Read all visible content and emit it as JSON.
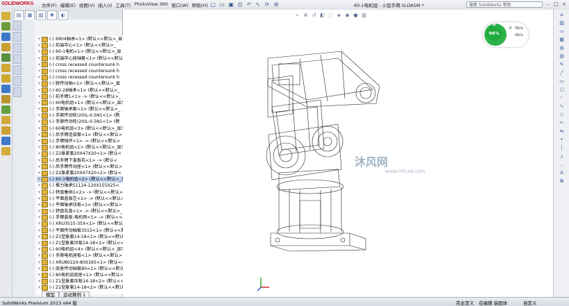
{
  "app": {
    "logo": "SOLIDWORKS",
    "menu": [
      "文件(F)",
      "编辑(E)",
      "视图(V)",
      "插入(I)",
      "工具(T)",
      "PhotoView 360",
      "窗口(W)",
      "帮助(H)"
    ],
    "document_title": "60-1电机组 - 小型手臂.SLDASM *",
    "search_placeholder": "搜索 SolidWorks 帮助"
  },
  "gauge": {
    "percent_label": "96%",
    "percent": 0.96,
    "legend": [
      "0",
      "0K/s",
      "0K/s"
    ]
  },
  "tree": {
    "items": [
      "(-) 6904轴承<1> (默认<<默认>_显",
      "(-) 前端中心<1> (默认<<默认>_",
      "(-) 60-1电机<1> (默认<<默认>_显",
      "(-) 前端中心座轴套<1> (默认<<默认>",
      "(-) cross recessed countersunk h",
      "(-) cross recessed countersunk h",
      "(-) cross recessed countersunk h",
      "(-) 腕传动轴<1> (默认<<默认>_显",
      "(-) 60-28轴承<1> (默认<<默认>_",
      "(-) 前手臂1<1> -> (默认<<默认>_",
      "(-) 60电机组<1> (默认<<默认>_显示",
      "(-) 手腕轴承套<1> (默认<<默认>_",
      "(-) 手腕传动轮(20)L-0.5N1<1> (默",
      "(-) 手腕传动轮(20)L-0.5N1<1> (默",
      "(-) 60电机组<3> (默认<<默认>_显示",
      "(-) 后手臂连接套<1> (默认<<默认>",
      "(-) 手臂挡环<1> -> (默认<<默认>",
      "(-) 80电机组<1> (默认<<默认>_显示",
      "(-) Z2胀紧套20X47X20<1> (默认<",
      "(-) 后手臂下盖板右<1> -> (默认<",
      "(-) 后手臂传动座<1> (默认<<默认>",
      "(-) Z2胀紧套20X47X20<2> (默认<",
      "(-) 60-1电机组<2> (默认<<默认>_显",
      "(-) 推力轴承51124-120X155X25<",
      "(-) 转盘垂拱1<2> -> (默认<<默认>",
      "(-) 平面盖板左<1> -> (默认<<默认>",
      "(-) 平面轴承压板<1> (默认<<默认>",
      "(-) 转盘右盖<1> -> (默认<<默认>_",
      "(-) 手臂盖板-电机侧<1> -> (默认<<默",
      "(-) XRU3515-35X<1> (默认<<默认",
      "(-) 平面传动轴套3515<1> (默认<<默",
      "(-) Z1型胀套14-18<1> (默认<<默认",
      "(-) Z1型胀套压板14-18<1> (默认<<",
      "(-) 60电机组<4> (默认<<默认>_显示",
      "(-) 手腕电机座板<1> (默认<<默认>",
      "(-) XRU8022X-80X165<1> (默认<<",
      "(-) 底座传动轴套80<1> (默认<<默认",
      "(-) 80电机组底座<1> (默认<<默认>_显",
      "(-) Z1型胀套压板14-18<2> (默认<<",
      "(-) Z1型胀套14-18<2> (默认<<默认"
    ],
    "selected_index": 22
  },
  "bottom_tabs": [
    "模型",
    "运动算例 1"
  ],
  "status": {
    "left": "SolidWorks Premium 2013 x64 版",
    "right1": "完全定义",
    "right2": "在编辑 装配体",
    "right3": "自定义"
  },
  "watermark": {
    "main": "沐风网",
    "sub": "www.mfcad.com"
  },
  "colors": {
    "accent": "#c8102e",
    "gauge": "#1ea93c",
    "selection": "#c7d7f2"
  }
}
